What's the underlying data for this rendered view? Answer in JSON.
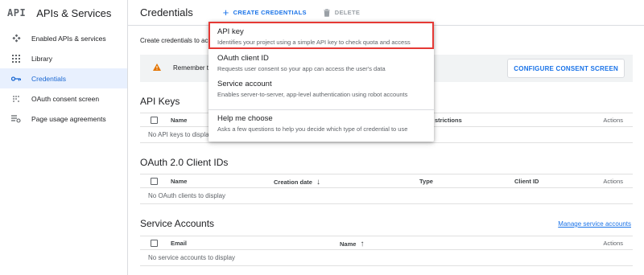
{
  "app": {
    "logo": "API",
    "title": "APIs & Services"
  },
  "sidebar": {
    "items": [
      {
        "label": "Enabled APIs & services",
        "icon": "api-diamond-icon",
        "active": false
      },
      {
        "label": "Library",
        "icon": "library-grid-icon",
        "active": false
      },
      {
        "label": "Credentials",
        "icon": "key-icon",
        "active": true
      },
      {
        "label": "OAuth consent screen",
        "icon": "consent-dots-icon",
        "active": false
      },
      {
        "label": "Page usage agreements",
        "icon": "settings-list-icon",
        "active": false
      }
    ]
  },
  "header": {
    "title": "Credentials",
    "create_label": "CREATE CREDENTIALS",
    "delete_label": "DELETE"
  },
  "main": {
    "intro": "Create credentials to ac",
    "banner": {
      "text": "Remember t",
      "button": "CONFIGURE CONSENT SCREEN"
    }
  },
  "dropdown": {
    "items": [
      {
        "label": "API key",
        "desc": "Identifies your project using a simple API key to check quota and access"
      },
      {
        "label": "OAuth client ID",
        "desc": "Requests user consent so your app can access the user's data"
      },
      {
        "label": "Service account",
        "desc": "Enables server-to-server, app-level authentication using robot accounts"
      },
      {
        "label": "Help me choose",
        "desc": "Asks a few questions to help you decide which type of credential to use"
      }
    ]
  },
  "api_keys": {
    "title": "API Keys",
    "columns": {
      "name": "Name",
      "restrictions": "strictions",
      "actions": "Actions"
    },
    "empty": "No API keys to displa"
  },
  "oauth": {
    "title": "OAuth 2.0 Client IDs",
    "columns": {
      "name": "Name",
      "created": "Creation date",
      "type": "Type",
      "client_id": "Client ID",
      "actions": "Actions"
    },
    "empty": "No OAuth clients to display"
  },
  "service_accounts": {
    "title": "Service Accounts",
    "manage_link": "Manage service accounts",
    "columns": {
      "email": "Email",
      "name": "Name",
      "actions": "Actions"
    },
    "empty": "No service accounts to display"
  },
  "colors": {
    "accent": "#1a73e8",
    "active_bg": "#e8f0fe",
    "highlight_border": "#e53935",
    "warning": "#e37400"
  }
}
